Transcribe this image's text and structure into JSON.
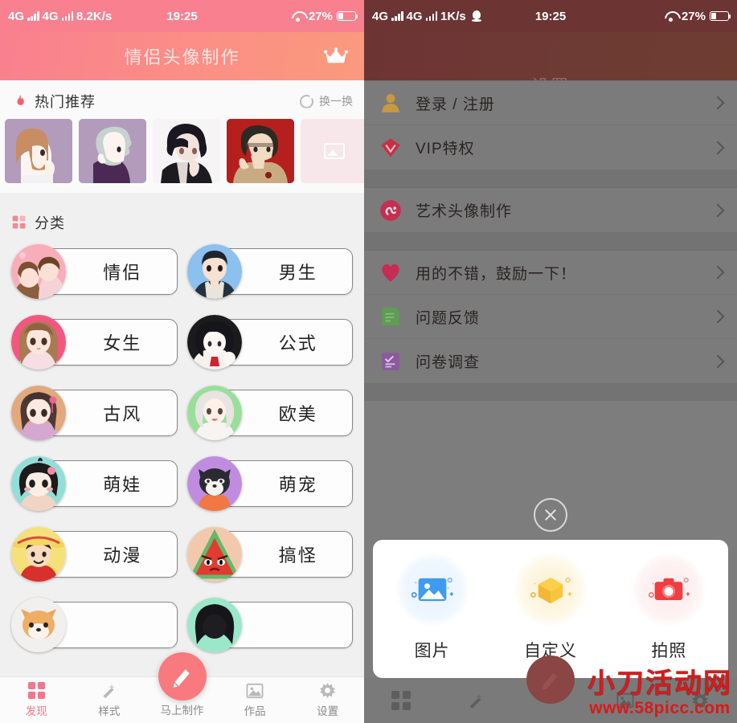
{
  "left": {
    "statusbar": {
      "net1": "4G",
      "net2": "4G",
      "speed": "8.2K/s",
      "time": "19:25",
      "battery": "27%"
    },
    "header": {
      "title": "情侣头像制作",
      "vip_icon": "crown-icon"
    },
    "hot": {
      "icon": "flame-icon",
      "title": "热门推荐",
      "refresh_label": "换一换",
      "refresh_icon": "refresh-icon",
      "thumbs": [
        {
          "name": "thumb-girl-brown-hair"
        },
        {
          "name": "thumb-boy-silver-hair"
        },
        {
          "name": "thumb-boy-black-hair"
        },
        {
          "name": "thumb-boy-red-bg"
        },
        {
          "name": "thumb-placeholder"
        }
      ]
    },
    "categories": {
      "icon": "grid-icon",
      "title": "分类",
      "items": [
        {
          "label": "情侣",
          "avatar": "couple-avatar"
        },
        {
          "label": "男生",
          "avatar": "boy-avatar"
        },
        {
          "label": "女生",
          "avatar": "girl-avatar"
        },
        {
          "label": "公式",
          "avatar": "formula-avatar"
        },
        {
          "label": "古风",
          "avatar": "ancient-avatar"
        },
        {
          "label": "欧美",
          "avatar": "western-avatar"
        },
        {
          "label": "萌娃",
          "avatar": "kid-avatar"
        },
        {
          "label": "萌宠",
          "avatar": "pet-avatar"
        },
        {
          "label": "动漫",
          "avatar": "anime-avatar"
        },
        {
          "label": "搞怪",
          "avatar": "funny-avatar"
        },
        {
          "label": "",
          "avatar": "fox-avatar"
        },
        {
          "label": "",
          "avatar": "dark-avatar"
        }
      ]
    },
    "tabbar": {
      "items": [
        {
          "label": "发现",
          "icon": "grid-icon",
          "active": true
        },
        {
          "label": "样式",
          "icon": "wand-icon",
          "active": false
        },
        {
          "label": "马上制作",
          "icon": "pencil-icon",
          "active": false
        },
        {
          "label": "作品",
          "icon": "image-icon",
          "active": false
        },
        {
          "label": "设置",
          "icon": "gear-icon",
          "active": false
        }
      ]
    }
  },
  "right": {
    "statusbar": {
      "net1": "4G",
      "net2": "4G",
      "speed": "1K/s",
      "qq_icon": "qq-icon",
      "time": "19:25",
      "battery": "27%"
    },
    "header": {
      "title": "设置"
    },
    "groups": [
      {
        "rows": [
          {
            "label": "登录 / 注册",
            "icon": "user-icon"
          },
          {
            "label": "VIP特权",
            "icon": "vip-diamond-icon"
          }
        ]
      },
      {
        "rows": [
          {
            "label": "艺术头像制作",
            "icon": "art-avatar-icon"
          }
        ]
      },
      {
        "rows": [
          {
            "label": "用的不错，鼓励一下！",
            "icon": "heart-icon"
          },
          {
            "label": "问题反馈",
            "icon": "note-icon"
          },
          {
            "label": "问卷调查",
            "icon": "survey-icon"
          }
        ]
      }
    ],
    "close_button": {
      "icon": "close-icon"
    },
    "sheet": {
      "items": [
        {
          "label": "图片",
          "icon": "picture-icon",
          "color": "#3e9bf0"
        },
        {
          "label": "自定义",
          "icon": "cube-icon",
          "color": "#f6bf3c"
        },
        {
          "label": "拍照",
          "icon": "camera-icon",
          "color": "#ef3d42"
        }
      ]
    },
    "tabbar": {
      "items": [
        {
          "label": "",
          "icon": "grid-icon"
        },
        {
          "label": "",
          "icon": "wand-icon"
        },
        {
          "label": "",
          "icon": "pencil-icon"
        },
        {
          "label": "",
          "icon": "image-icon"
        },
        {
          "label": "",
          "icon": "gear-icon"
        }
      ]
    }
  },
  "watermark": {
    "line1": "小刀活动网",
    "line2": "www.58picc.com",
    "color": "#d91a1a"
  }
}
